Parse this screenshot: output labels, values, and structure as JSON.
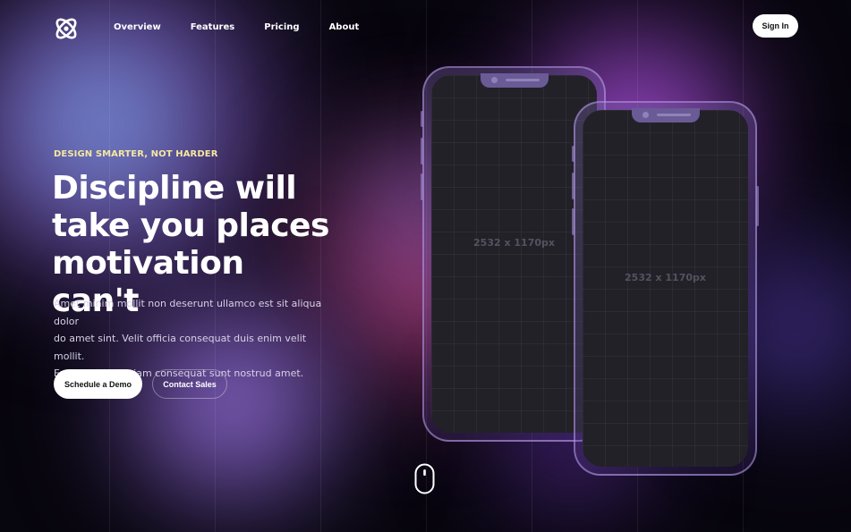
{
  "brand": {
    "logo_icon": "atom-icon"
  },
  "nav": {
    "items": [
      {
        "label": "Overview"
      },
      {
        "label": "Features"
      },
      {
        "label": "Pricing"
      },
      {
        "label": "About"
      }
    ]
  },
  "header": {
    "signin_label": "Sign In"
  },
  "hero": {
    "eyebrow": "DESIGN SMARTER, NOT HARDER",
    "headline_lines": [
      "Discipline will",
      "take you places",
      "motivation can't"
    ],
    "description_lines": [
      "Amet minim mollit non deserunt ullamco est sit aliqua dolor",
      "do amet sint. Velit officia consequat duis enim velit mollit.",
      "Exercitation veniam consequat sunt nostrud amet."
    ],
    "primary_button": "Schedule a Demo",
    "secondary_button": "Contact Sales"
  },
  "mockups": {
    "phone_1_label": "2532 x 1170px",
    "phone_2_label": "2532 x 1170px"
  },
  "scroll": {
    "icon": "mouse-scroll-icon"
  },
  "colors": {
    "eyebrow": "#f5e7a1",
    "background": "#07050d",
    "accent_purple": "#b24dd1"
  }
}
